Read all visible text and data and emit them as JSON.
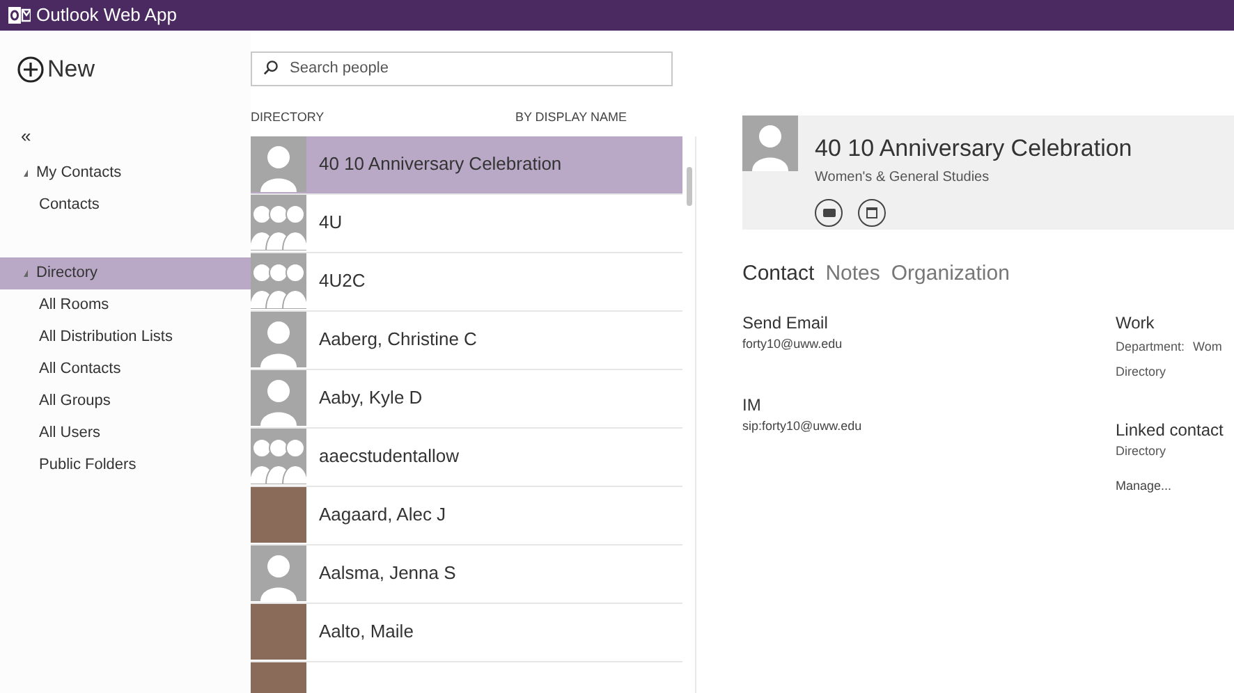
{
  "app_bar": {
    "title": "Outlook Web App"
  },
  "new_button": {
    "label": "New"
  },
  "search": {
    "placeholder": "Search people"
  },
  "sidebar": {
    "collapse": "«",
    "items": [
      {
        "label": "My Contacts",
        "kind": "header",
        "selected": false,
        "expanded": true
      },
      {
        "label": "Contacts",
        "kind": "item",
        "selected": false
      },
      {
        "label": "Directory",
        "kind": "header",
        "selected": true,
        "expanded": true
      },
      {
        "label": "All Rooms",
        "kind": "item",
        "selected": false
      },
      {
        "label": "All Distribution Lists",
        "kind": "item",
        "selected": false
      },
      {
        "label": "All Contacts",
        "kind": "item",
        "selected": false
      },
      {
        "label": "All Groups",
        "kind": "item",
        "selected": false
      },
      {
        "label": "All Users",
        "kind": "item",
        "selected": false
      },
      {
        "label": "Public Folders",
        "kind": "item",
        "selected": false
      }
    ]
  },
  "list": {
    "heading": "DIRECTORY",
    "sort": "BY DISPLAY NAME",
    "rows": [
      {
        "name": "40 10 Anniversary Celebration",
        "kind": "person",
        "selected": true
      },
      {
        "name": "4U",
        "kind": "group",
        "selected": false
      },
      {
        "name": "4U2C",
        "kind": "group",
        "selected": false
      },
      {
        "name": "Aaberg, Christine C",
        "kind": "person",
        "selected": false
      },
      {
        "name": "Aaby, Kyle D",
        "kind": "person",
        "selected": false
      },
      {
        "name": "aaecstudentallow",
        "kind": "group",
        "selected": false
      },
      {
        "name": "Aagaard, Alec J",
        "kind": "photo",
        "selected": false
      },
      {
        "name": "Aalsma, Jenna S",
        "kind": "person",
        "selected": false
      },
      {
        "name": "Aalto, Maile",
        "kind": "photo",
        "selected": false
      },
      {
        "kind": "photo",
        "selected": false
      }
    ]
  },
  "detail": {
    "name": "40 10 Anniversary Celebration",
    "subtitle": "Women's & General Studies",
    "tabs": [
      {
        "label": "Contact",
        "selected": true
      },
      {
        "label": "Notes",
        "selected": false
      },
      {
        "label": "Organization",
        "selected": false
      }
    ],
    "left": [
      {
        "title": "Send Email",
        "value": "forty10@uww.edu"
      },
      {
        "title": "IM",
        "value": "sip:forty10@uww.edu"
      }
    ],
    "work": {
      "title": "Work",
      "label": "Department:",
      "value": "Wom",
      "source": "Directory"
    },
    "linked": {
      "title": "Linked contact",
      "source": "Directory",
      "action": "Manage..."
    }
  }
}
